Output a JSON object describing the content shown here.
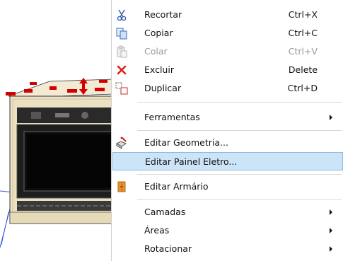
{
  "menu": {
    "items": [
      {
        "label": "Recortar",
        "shortcut": "Ctrl+X",
        "icon": "scissors-icon",
        "enabled": true
      },
      {
        "label": "Copiar",
        "shortcut": "Ctrl+C",
        "icon": "copy-icon",
        "enabled": true
      },
      {
        "label": "Colar",
        "shortcut": "Ctrl+V",
        "icon": "paste-icon",
        "enabled": false
      },
      {
        "label": "Excluir",
        "shortcut": "Delete",
        "icon": "delete-x-icon",
        "enabled": true
      },
      {
        "label": "Duplicar",
        "shortcut": "Ctrl+D",
        "icon": "duplicate-icon",
        "enabled": true
      },
      {
        "label": "Ferramentas",
        "submenu": true
      },
      {
        "label": "Editar Geometria...",
        "icon": "geometry-edit-icon"
      },
      {
        "label": "Editar Painel Eletro...",
        "highlighted": true
      },
      {
        "label": "Editar Armário",
        "icon": "cabinet-icon"
      },
      {
        "label": "Camadas",
        "submenu": true
      },
      {
        "label": "Áreas",
        "submenu": true
      },
      {
        "label": "Rotacionar",
        "submenu": true
      }
    ]
  },
  "colors": {
    "highlight": "#cce4f7",
    "highlight_border": "#8fb8dd",
    "handles": "#d40000",
    "cabinet_wood": "#efe3c6"
  }
}
